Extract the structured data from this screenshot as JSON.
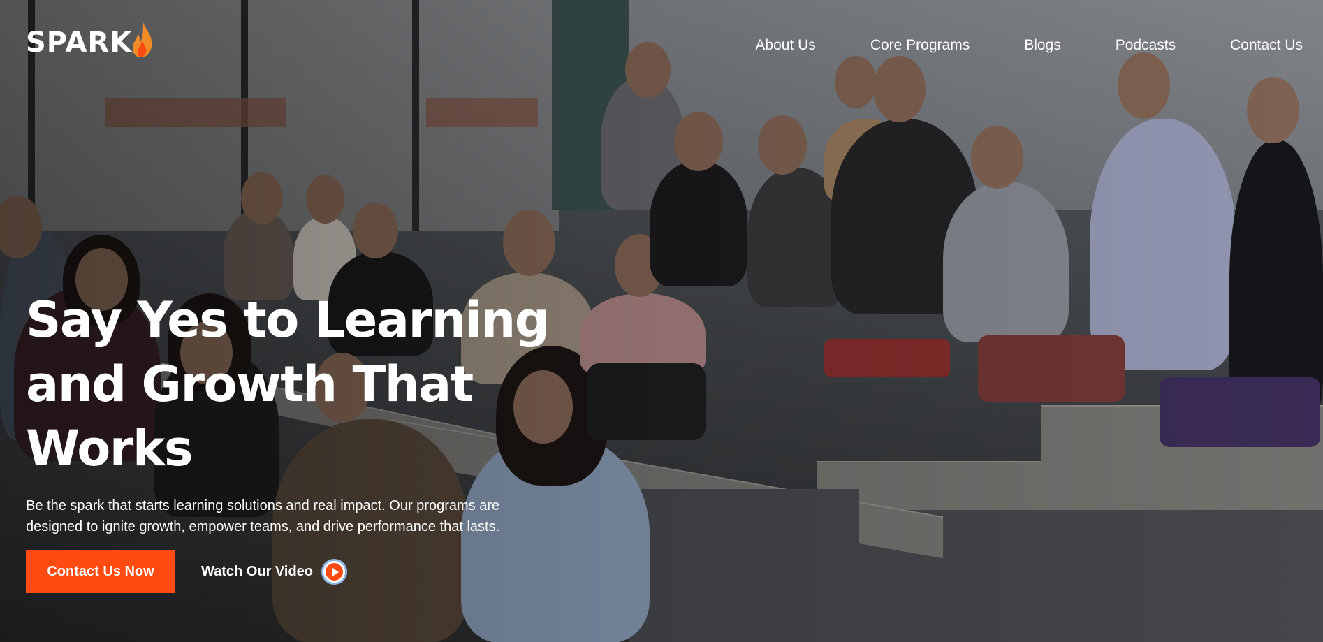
{
  "brand": {
    "logo_text": "SPARK",
    "accent_color": "#ff4b12",
    "flame_color": "#f28c28"
  },
  "nav": {
    "items": [
      {
        "label": "About Us"
      },
      {
        "label": "Core Programs"
      },
      {
        "label": "Blogs"
      },
      {
        "label": "Podcasts"
      },
      {
        "label": "Contact Us"
      }
    ]
  },
  "hero": {
    "title_lines": [
      "Say Yes to Learning",
      "and Growth That",
      "Works"
    ],
    "subtitle_lines": [
      "Be the spark that starts learning solutions and real impact. Our programs are",
      "designed to ignite growth, empower teams, and drive performance that lasts."
    ],
    "primary_cta": "Contact Us Now",
    "video_cta": "Watch Our Video",
    "video_icon": "play-icon",
    "background": "Group photo of training participants in a classroom"
  }
}
